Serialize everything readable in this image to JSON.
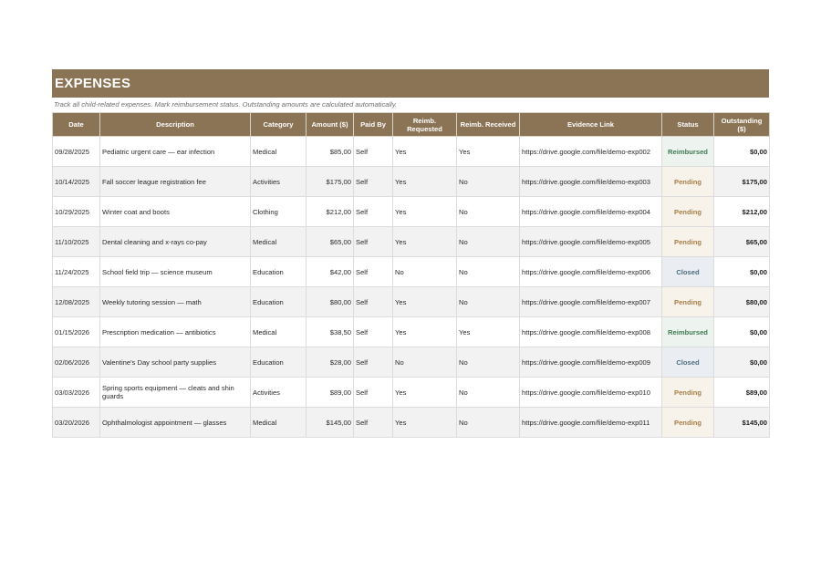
{
  "title": "EXPENSES",
  "subtitle": "Track all child-related expenses. Mark reimbursement status. Outstanding amounts are calculated automatically.",
  "columns": [
    "Date",
    "Description",
    "Category",
    "Amount ($)",
    "Paid By",
    "Reimb. Requested",
    "Reimb. Received",
    "Evidence Link",
    "Status",
    "Outstanding ($)"
  ],
  "rows": [
    {
      "date": "09/28/2025",
      "description": "Pediatric urgent care — ear infection",
      "category": "Medical",
      "amount": "$85,00",
      "paid_by": "Self",
      "requested": "Yes",
      "received": "Yes",
      "link": "https://drive.google.com/file/demo-exp002",
      "status": "Reimbursed",
      "outstanding": "$0,00"
    },
    {
      "date": "10/14/2025",
      "description": "Fall soccer league registration fee",
      "category": "Activities",
      "amount": "$175,00",
      "paid_by": "Self",
      "requested": "Yes",
      "received": "No",
      "link": "https://drive.google.com/file/demo-exp003",
      "status": "Pending",
      "outstanding": "$175,00"
    },
    {
      "date": "10/29/2025",
      "description": "Winter coat and boots",
      "category": "Clothing",
      "amount": "$212,00",
      "paid_by": "Self",
      "requested": "Yes",
      "received": "No",
      "link": "https://drive.google.com/file/demo-exp004",
      "status": "Pending",
      "outstanding": "$212,00"
    },
    {
      "date": "11/10/2025",
      "description": "Dental cleaning and x-rays co-pay",
      "category": "Medical",
      "amount": "$65,00",
      "paid_by": "Self",
      "requested": "Yes",
      "received": "No",
      "link": "https://drive.google.com/file/demo-exp005",
      "status": "Pending",
      "outstanding": "$65,00"
    },
    {
      "date": "11/24/2025",
      "description": "School field trip — science museum",
      "category": "Education",
      "amount": "$42,00",
      "paid_by": "Self",
      "requested": "No",
      "received": "No",
      "link": "https://drive.google.com/file/demo-exp006",
      "status": "Closed",
      "outstanding": "$0,00"
    },
    {
      "date": "12/08/2025",
      "description": "Weekly tutoring session — math",
      "category": "Education",
      "amount": "$80,00",
      "paid_by": "Self",
      "requested": "Yes",
      "received": "No",
      "link": "https://drive.google.com/file/demo-exp007",
      "status": "Pending",
      "outstanding": "$80,00"
    },
    {
      "date": "01/15/2026",
      "description": "Prescription medication — antibiotics",
      "category": "Medical",
      "amount": "$38,50",
      "paid_by": "Self",
      "requested": "Yes",
      "received": "Yes",
      "link": "https://drive.google.com/file/demo-exp008",
      "status": "Reimbursed",
      "outstanding": "$0,00"
    },
    {
      "date": "02/06/2026",
      "description": "Valentine's Day school party supplies",
      "category": "Education",
      "amount": "$28,00",
      "paid_by": "Self",
      "requested": "No",
      "received": "No",
      "link": "https://drive.google.com/file/demo-exp009",
      "status": "Closed",
      "outstanding": "$0,00"
    },
    {
      "date": "03/03/2026",
      "description": "Spring sports equipment — cleats and shin guards",
      "category": "Activities",
      "amount": "$89,00",
      "paid_by": "Self",
      "requested": "Yes",
      "received": "No",
      "link": "https://drive.google.com/file/demo-exp010",
      "status": "Pending",
      "outstanding": "$89,00"
    },
    {
      "date": "03/20/2026",
      "description": "Ophthalmologist appointment — glasses",
      "category": "Medical",
      "amount": "$145,00",
      "paid_by": "Self",
      "requested": "Yes",
      "received": "No",
      "link": "https://drive.google.com/file/demo-exp011",
      "status": "Pending",
      "outstanding": "$145,00"
    }
  ]
}
